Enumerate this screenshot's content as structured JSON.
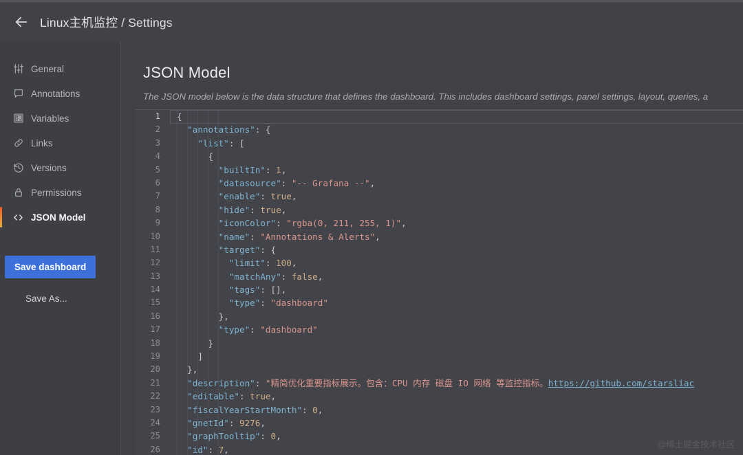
{
  "header": {
    "back_icon": "arrow-left-icon",
    "breadcrumb": "Linux主机监控 / Settings"
  },
  "sidebar": {
    "items": [
      {
        "label": "General",
        "icon": "sliders-icon",
        "active": false
      },
      {
        "label": "Annotations",
        "icon": "comment-icon",
        "active": false
      },
      {
        "label": "Variables",
        "icon": "grid-icon",
        "active": false
      },
      {
        "label": "Links",
        "icon": "link-icon",
        "active": false
      },
      {
        "label": "Versions",
        "icon": "history-icon",
        "active": false
      },
      {
        "label": "Permissions",
        "icon": "lock-icon",
        "active": false
      },
      {
        "label": "JSON Model",
        "icon": "code-icon",
        "active": true
      }
    ],
    "save_dashboard_label": "Save dashboard",
    "save_as_label": "Save As...",
    "save_button_color": "#3d71d9",
    "active_indicator_color": "#f05a28"
  },
  "main": {
    "title": "JSON Model",
    "description": "The JSON model below is the data structure that defines the dashboard. This includes dashboard settings, panel settings, layout, queries, a"
  },
  "editor": {
    "current_line": 1,
    "lines": [
      {
        "n": 1,
        "tokens": [
          {
            "t": "punct",
            "v": "{"
          }
        ]
      },
      {
        "n": 2,
        "tokens": [
          {
            "t": "plain",
            "v": "  "
          },
          {
            "t": "key",
            "v": "\"annotations\""
          },
          {
            "t": "punct",
            "v": ": {"
          }
        ]
      },
      {
        "n": 3,
        "tokens": [
          {
            "t": "plain",
            "v": "    "
          },
          {
            "t": "key",
            "v": "\"list\""
          },
          {
            "t": "punct",
            "v": ": ["
          }
        ]
      },
      {
        "n": 4,
        "tokens": [
          {
            "t": "plain",
            "v": "      "
          },
          {
            "t": "punct",
            "v": "{"
          }
        ]
      },
      {
        "n": 5,
        "tokens": [
          {
            "t": "plain",
            "v": "        "
          },
          {
            "t": "key",
            "v": "\"builtIn\""
          },
          {
            "t": "punct",
            "v": ": "
          },
          {
            "t": "num",
            "v": "1"
          },
          {
            "t": "punct",
            "v": ","
          }
        ]
      },
      {
        "n": 6,
        "tokens": [
          {
            "t": "plain",
            "v": "        "
          },
          {
            "t": "key",
            "v": "\"datasource\""
          },
          {
            "t": "punct",
            "v": ": "
          },
          {
            "t": "str",
            "v": "\"-- Grafana --\""
          },
          {
            "t": "punct",
            "v": ","
          }
        ]
      },
      {
        "n": 7,
        "tokens": [
          {
            "t": "plain",
            "v": "        "
          },
          {
            "t": "key",
            "v": "\"enable\""
          },
          {
            "t": "punct",
            "v": ": "
          },
          {
            "t": "bool",
            "v": "true"
          },
          {
            "t": "punct",
            "v": ","
          }
        ]
      },
      {
        "n": 8,
        "tokens": [
          {
            "t": "plain",
            "v": "        "
          },
          {
            "t": "key",
            "v": "\"hide\""
          },
          {
            "t": "punct",
            "v": ": "
          },
          {
            "t": "bool",
            "v": "true"
          },
          {
            "t": "punct",
            "v": ","
          }
        ]
      },
      {
        "n": 9,
        "tokens": [
          {
            "t": "plain",
            "v": "        "
          },
          {
            "t": "key",
            "v": "\"iconColor\""
          },
          {
            "t": "punct",
            "v": ": "
          },
          {
            "t": "str",
            "v": "\"rgba(0, 211, 255, 1)\""
          },
          {
            "t": "punct",
            "v": ","
          }
        ]
      },
      {
        "n": 10,
        "tokens": [
          {
            "t": "plain",
            "v": "        "
          },
          {
            "t": "key",
            "v": "\"name\""
          },
          {
            "t": "punct",
            "v": ": "
          },
          {
            "t": "str",
            "v": "\"Annotations & Alerts\""
          },
          {
            "t": "punct",
            "v": ","
          }
        ]
      },
      {
        "n": 11,
        "tokens": [
          {
            "t": "plain",
            "v": "        "
          },
          {
            "t": "key",
            "v": "\"target\""
          },
          {
            "t": "punct",
            "v": ": {"
          }
        ]
      },
      {
        "n": 12,
        "tokens": [
          {
            "t": "plain",
            "v": "          "
          },
          {
            "t": "key",
            "v": "\"limit\""
          },
          {
            "t": "punct",
            "v": ": "
          },
          {
            "t": "num",
            "v": "100"
          },
          {
            "t": "punct",
            "v": ","
          }
        ]
      },
      {
        "n": 13,
        "tokens": [
          {
            "t": "plain",
            "v": "          "
          },
          {
            "t": "key",
            "v": "\"matchAny\""
          },
          {
            "t": "punct",
            "v": ": "
          },
          {
            "t": "bool",
            "v": "false"
          },
          {
            "t": "punct",
            "v": ","
          }
        ]
      },
      {
        "n": 14,
        "tokens": [
          {
            "t": "plain",
            "v": "          "
          },
          {
            "t": "key",
            "v": "\"tags\""
          },
          {
            "t": "punct",
            "v": ": [],"
          }
        ]
      },
      {
        "n": 15,
        "tokens": [
          {
            "t": "plain",
            "v": "          "
          },
          {
            "t": "key",
            "v": "\"type\""
          },
          {
            "t": "punct",
            "v": ": "
          },
          {
            "t": "str",
            "v": "\"dashboard\""
          }
        ]
      },
      {
        "n": 16,
        "tokens": [
          {
            "t": "plain",
            "v": "        "
          },
          {
            "t": "punct",
            "v": "},"
          }
        ]
      },
      {
        "n": 17,
        "tokens": [
          {
            "t": "plain",
            "v": "        "
          },
          {
            "t": "key",
            "v": "\"type\""
          },
          {
            "t": "punct",
            "v": ": "
          },
          {
            "t": "str",
            "v": "\"dashboard\""
          }
        ]
      },
      {
        "n": 18,
        "tokens": [
          {
            "t": "plain",
            "v": "      "
          },
          {
            "t": "punct",
            "v": "}"
          }
        ]
      },
      {
        "n": 19,
        "tokens": [
          {
            "t": "plain",
            "v": "    "
          },
          {
            "t": "punct",
            "v": "]"
          }
        ]
      },
      {
        "n": 20,
        "tokens": [
          {
            "t": "plain",
            "v": "  "
          },
          {
            "t": "punct",
            "v": "},"
          }
        ]
      },
      {
        "n": 21,
        "tokens": [
          {
            "t": "plain",
            "v": "  "
          },
          {
            "t": "key",
            "v": "\"description\""
          },
          {
            "t": "punct",
            "v": ": "
          },
          {
            "t": "str",
            "v": "\"精简优化重要指标展示。包含：CPU 内存 磁盘 IO 网络 等监控指标。"
          },
          {
            "t": "link",
            "v": "https://github.com/starsliac"
          }
        ]
      },
      {
        "n": 22,
        "tokens": [
          {
            "t": "plain",
            "v": "  "
          },
          {
            "t": "key",
            "v": "\"editable\""
          },
          {
            "t": "punct",
            "v": ": "
          },
          {
            "t": "bool",
            "v": "true"
          },
          {
            "t": "punct",
            "v": ","
          }
        ]
      },
      {
        "n": 23,
        "tokens": [
          {
            "t": "plain",
            "v": "  "
          },
          {
            "t": "key",
            "v": "\"fiscalYearStartMonth\""
          },
          {
            "t": "punct",
            "v": ": "
          },
          {
            "t": "num",
            "v": "0"
          },
          {
            "t": "punct",
            "v": ","
          }
        ]
      },
      {
        "n": 24,
        "tokens": [
          {
            "t": "plain",
            "v": "  "
          },
          {
            "t": "key",
            "v": "\"gnetId\""
          },
          {
            "t": "punct",
            "v": ": "
          },
          {
            "t": "num",
            "v": "9276"
          },
          {
            "t": "punct",
            "v": ","
          }
        ]
      },
      {
        "n": 25,
        "tokens": [
          {
            "t": "plain",
            "v": "  "
          },
          {
            "t": "key",
            "v": "\"graphTooltip\""
          },
          {
            "t": "punct",
            "v": ": "
          },
          {
            "t": "num",
            "v": "0"
          },
          {
            "t": "punct",
            "v": ","
          }
        ]
      },
      {
        "n": 26,
        "tokens": [
          {
            "t": "plain",
            "v": "  "
          },
          {
            "t": "key",
            "v": "\"id\""
          },
          {
            "t": "punct",
            "v": ": "
          },
          {
            "t": "num",
            "v": "7"
          },
          {
            "t": "punct",
            "v": ","
          }
        ]
      }
    ]
  },
  "watermark": "@稀土掘金技术社区"
}
